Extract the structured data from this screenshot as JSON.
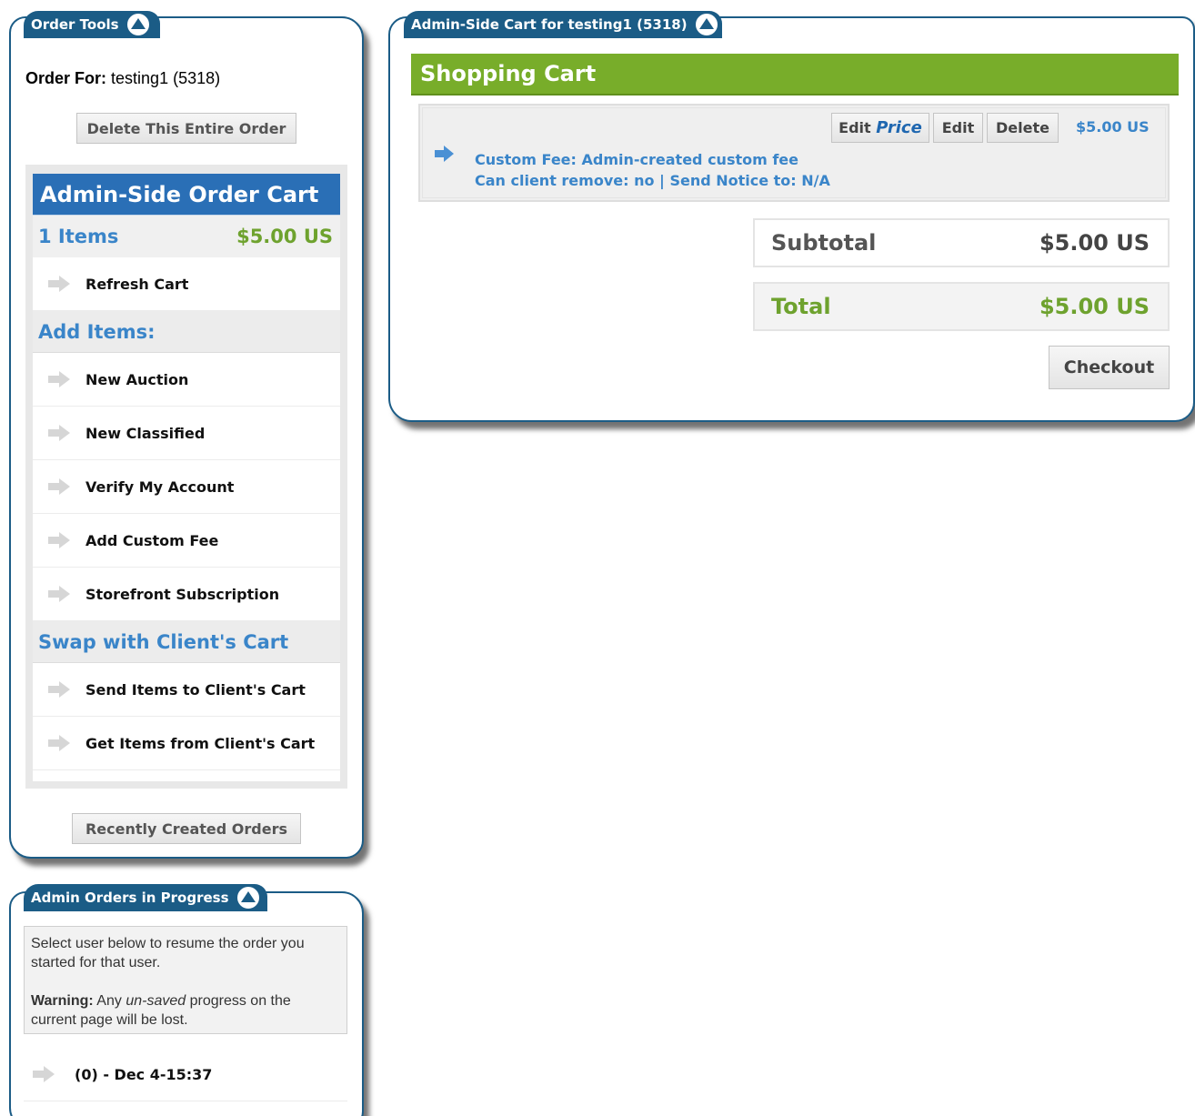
{
  "order_tools": {
    "tab_title": "Order Tools",
    "order_for_label": "Order For:",
    "order_for_value": "testing1 (5318)",
    "delete_button": "Delete This Entire Order",
    "cart": {
      "title": "Admin-Side Order Cart",
      "items_count": "1 Items",
      "total": "$5.00 US",
      "refresh_label": "Refresh Cart",
      "add_items_heading": "Add Items:",
      "add_items": [
        "New Auction",
        "New Classified",
        "Verify My Account",
        "Add Custom Fee",
        "Storefront Subscription"
      ],
      "swap_heading": "Swap with Client's Cart",
      "swap_items": [
        "Send Items to Client's Cart",
        "Get Items from Client's Cart"
      ]
    },
    "recent_button": "Recently Created Orders"
  },
  "admin_cart": {
    "tab_title": "Admin-Side Cart for testing1 (5318)",
    "heading": "Shopping Cart",
    "item": {
      "edit_price_prefix": "Edit",
      "edit_price_emph": "Price",
      "edit_label": "Edit",
      "delete_label": "Delete",
      "price": "$5.00 US",
      "line1": "Custom Fee: Admin-created custom fee",
      "line2": "Can client remove: no | Send Notice to: N/A"
    },
    "subtotal_label": "Subtotal",
    "subtotal_value": "$5.00 US",
    "total_label": "Total",
    "total_value": "$5.00 US",
    "checkout_label": "Checkout"
  },
  "in_progress": {
    "tab_title": "Admin Orders in Progress",
    "info_line": "Select user below to resume the order you started for that user.",
    "warning_label": "Warning:",
    "warning_pre": "Any",
    "warning_emph": "un-saved",
    "warning_post": "progress on the current page will be lost.",
    "orders": [
      "(0) - Dec 4-15:37"
    ]
  },
  "colors": {
    "panel_border": "#1b5c86",
    "cart_header_blue": "#2a6fb6",
    "shopping_cart_green": "#78ad2a",
    "price_green": "#6ea22e",
    "link_blue": "#3a85c9"
  }
}
